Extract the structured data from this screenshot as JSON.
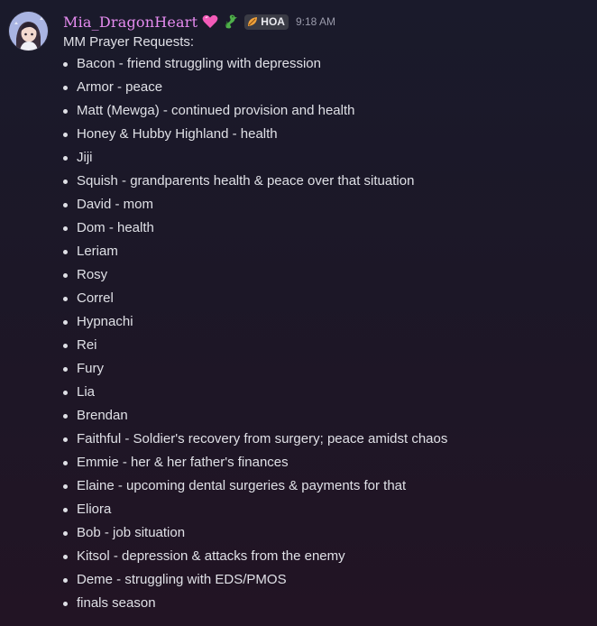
{
  "message": {
    "username": "Mia_DragonHeart",
    "username_color": "#e68cf0",
    "emojis": [
      "pink-heart-icon",
      "dragon-icon"
    ],
    "tag": {
      "icon": "leaf-icon",
      "label": "HOA"
    },
    "timestamp": "9:18 AM",
    "title": "MM Prayer Requests:",
    "items": [
      {
        "text": "Bacon - friend struggling with depression"
      },
      {
        "text": "Armor - peace"
      },
      {
        "text": "Matt (Mewga) - continued provision and health"
      },
      {
        "text": "Honey & Hubby Highland - health"
      },
      {
        "text": "Jiji"
      },
      {
        "text": "Squish - grandparents health & peace over that situation"
      },
      {
        "text": "David - mom"
      },
      {
        "text": "Dom - health"
      },
      {
        "text": "Leriam"
      },
      {
        "text": "Rosy"
      },
      {
        "text": "Correl"
      },
      {
        "text": "Hypnachi"
      },
      {
        "text": "Rei"
      },
      {
        "text": "Fury"
      },
      {
        "text": "Lia"
      },
      {
        "text": "Brendan"
      },
      {
        "text": "Faithful - Soldier's recovery from surgery; peace amidst chaos"
      },
      {
        "text": "Emmie - her & her father's finances"
      },
      {
        "text": "Elaine - upcoming dental surgeries & payments for that"
      },
      {
        "text": "Eliora"
      },
      {
        "text": "Bob - job situation"
      },
      {
        "text": "Kitsol - depression & attacks from the enemy"
      },
      {
        "text": "Deme - struggling with EDS/PMOS"
      },
      {
        "text": "finals season"
      }
    ]
  }
}
